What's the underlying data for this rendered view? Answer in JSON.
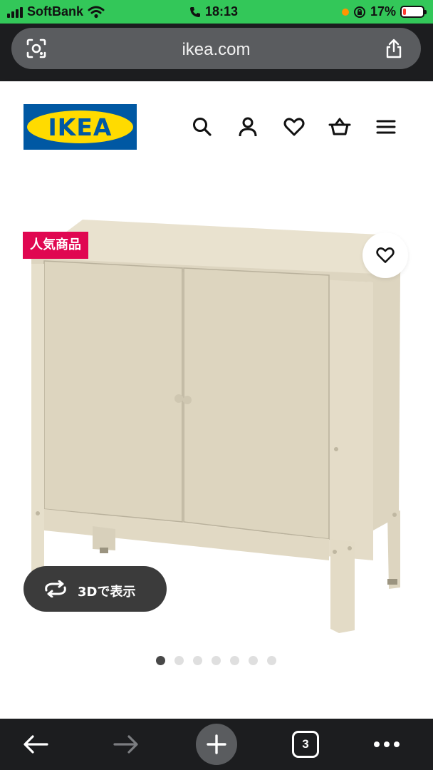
{
  "status_bar": {
    "carrier": "SoftBank",
    "time": "18:13",
    "battery_percent": "17%",
    "battery_level": 0.17
  },
  "browser": {
    "url": "ikea.com",
    "tab_count": "3"
  },
  "site": {
    "logo_text": "IKEA",
    "brand_colors": {
      "blue": "#0058a3",
      "yellow": "#ffdb00"
    }
  },
  "header_icons": [
    "search-icon",
    "account-icon",
    "favorites-icon",
    "cart-icon",
    "menu-icon"
  ],
  "product": {
    "badge": "人気商品",
    "badge_color": "#e00751",
    "view_3d_label": "3Dで表示",
    "image_count": 7,
    "active_image_index": 0
  }
}
